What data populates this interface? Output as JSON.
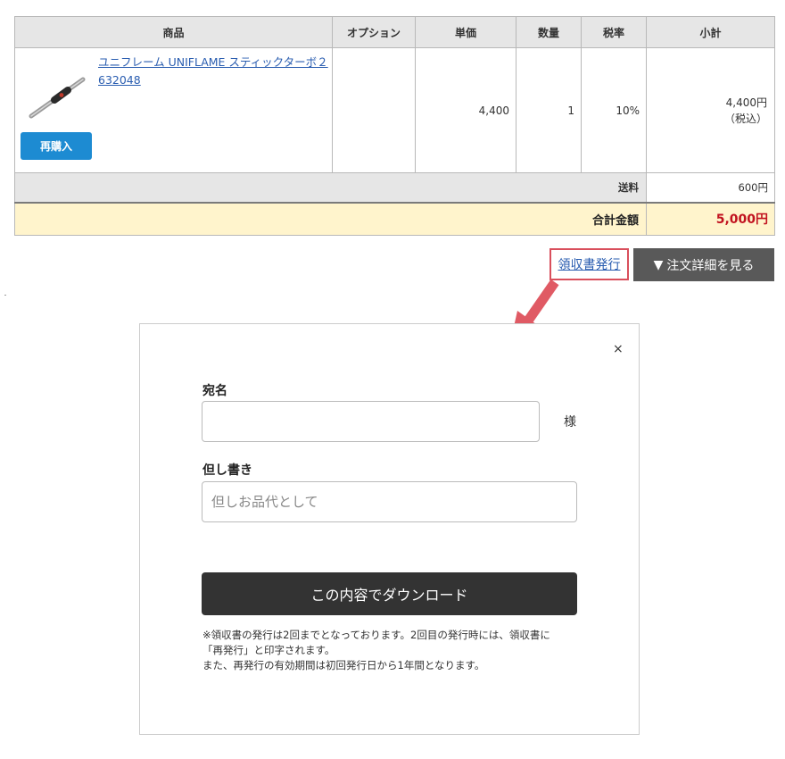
{
  "table": {
    "headers": {
      "product": "商品",
      "option": "オプション",
      "unit_price": "単価",
      "quantity": "数量",
      "tax_rate": "税率",
      "subtotal": "小計"
    },
    "item": {
      "name": "ユニフレーム UNIFLAME スティックターボ２632048",
      "option": "",
      "unit_price": "4,400",
      "quantity": "1",
      "tax_rate": "10%",
      "subtotal": "4,400円",
      "subtotal_note": "（税込）",
      "rebuy_label": "再購入",
      "image_icon": "stick-turbo-product-icon"
    },
    "shipping": {
      "label": "送料",
      "value": "600円"
    },
    "total": {
      "label": "合計金額",
      "value": "5,000円"
    }
  },
  "actions": {
    "receipt_link": "領収書発行",
    "detail_button": "注文詳細を見る",
    "detail_icon": "triangle-down-icon",
    "arrow_icon": "arrow-down-left-icon"
  },
  "modal": {
    "close": "×",
    "recipient_label": "宛名",
    "recipient_value": "",
    "recipient_suffix": "様",
    "note_label": "但し書き",
    "note_placeholder": "但しお品代として",
    "download_label": "この内容でダウンロード",
    "notice_lines": [
      "※領収書の発行は2回までとなっております。2回目の発行時には、領収書に",
      "「再発行」と印字されます。",
      "また、再発行の有効期間は初回発行日から1年間となります。"
    ]
  },
  "colors": {
    "link": "#2a5db0",
    "rebuy_button": "#1d8bd2",
    "highlight_box": "#d94f5c",
    "arrow": "#e05a64",
    "total_background": "#fff4cc",
    "total_value": "#c1121f",
    "dark_button": "#333333"
  }
}
